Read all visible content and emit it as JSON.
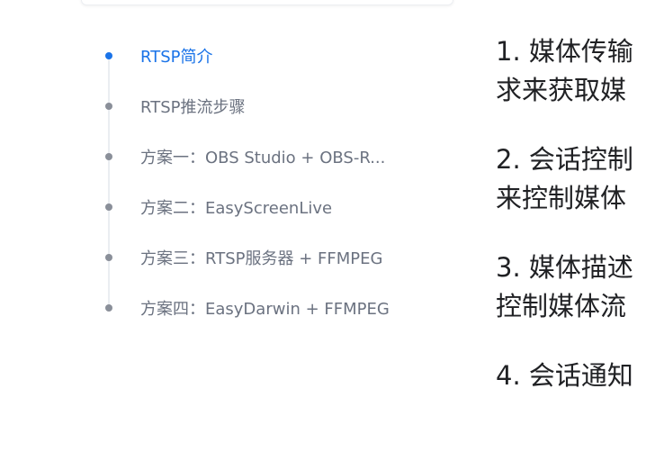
{
  "toc": {
    "items": [
      {
        "label": "RTSP简介",
        "active": true
      },
      {
        "label": "RTSP推流步骤",
        "active": false
      },
      {
        "label": "方案一：OBS Studio + OBS-R...",
        "active": false
      },
      {
        "label": "方案二：EasyScreenLive",
        "active": false
      },
      {
        "label": "方案三：RTSP服务器 + FFMPEG",
        "active": false
      },
      {
        "label": "方案四：EasyDarwin + FFMPEG",
        "active": false
      }
    ]
  },
  "article": {
    "paragraphs": [
      {
        "line1": "1. 媒体传输",
        "line2": "求来获取媒"
      },
      {
        "line1": "2. 会话控制",
        "line2": "来控制媒体"
      },
      {
        "line1": "3. 媒体描述",
        "line2": "控制媒体流"
      },
      {
        "line1": "4. 会话通知",
        "line2": ""
      }
    ]
  },
  "colors": {
    "accent": "#1a73e8",
    "muted_text": "#6b7280",
    "dot": "#8a8f99",
    "line": "#eaedf1"
  }
}
